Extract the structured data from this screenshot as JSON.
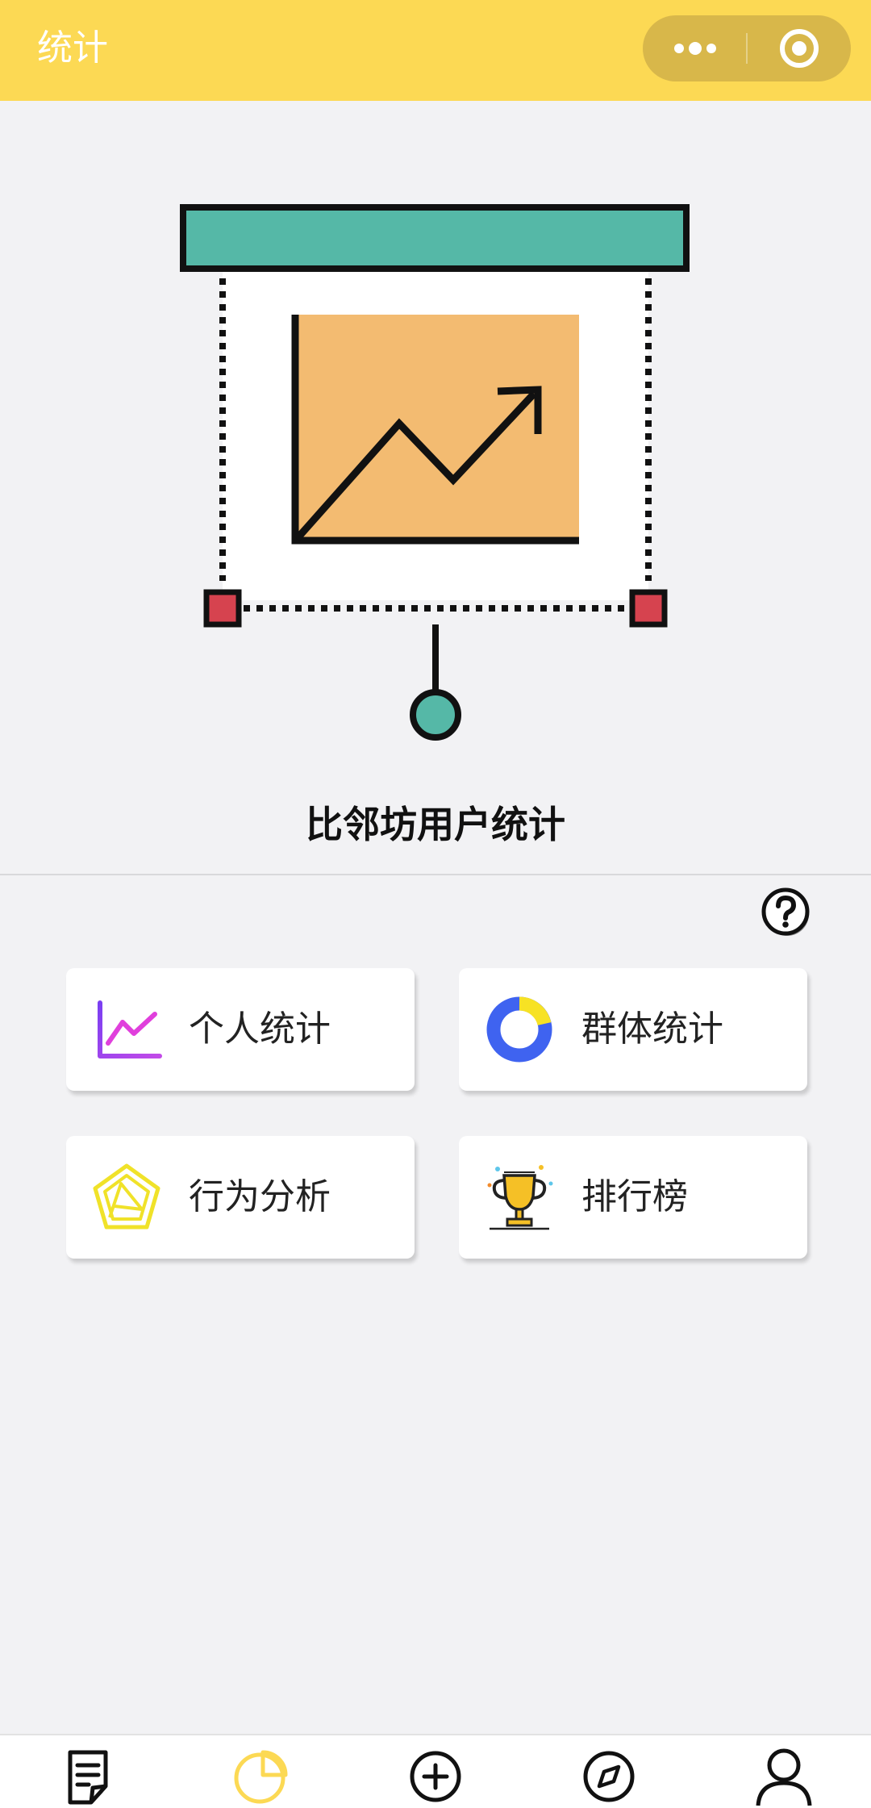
{
  "header": {
    "title": "统计"
  },
  "main": {
    "title": "比邻坊用户统计"
  },
  "cards": [
    {
      "label": "个人统计",
      "icon": "line-chart-icon"
    },
    {
      "label": "群体统计",
      "icon": "donut-chart-icon"
    },
    {
      "label": "行为分析",
      "icon": "pentagon-radar-icon"
    },
    {
      "label": "排行榜",
      "icon": "trophy-icon"
    }
  ],
  "tabbar": [
    {
      "icon": "document-icon",
      "active": false
    },
    {
      "icon": "pie-chart-icon",
      "active": true
    },
    {
      "icon": "plus-circle-icon",
      "active": false
    },
    {
      "icon": "compass-icon",
      "active": false
    },
    {
      "icon": "user-icon",
      "active": false
    }
  ],
  "colors": {
    "header_bg": "#fcd954",
    "page_bg": "#f2f2f4",
    "active_tab": "#fcd954",
    "illustration_board": "#f3bb71",
    "illustration_bar": "#55b8a7",
    "illustration_handle": "#d6434f"
  }
}
